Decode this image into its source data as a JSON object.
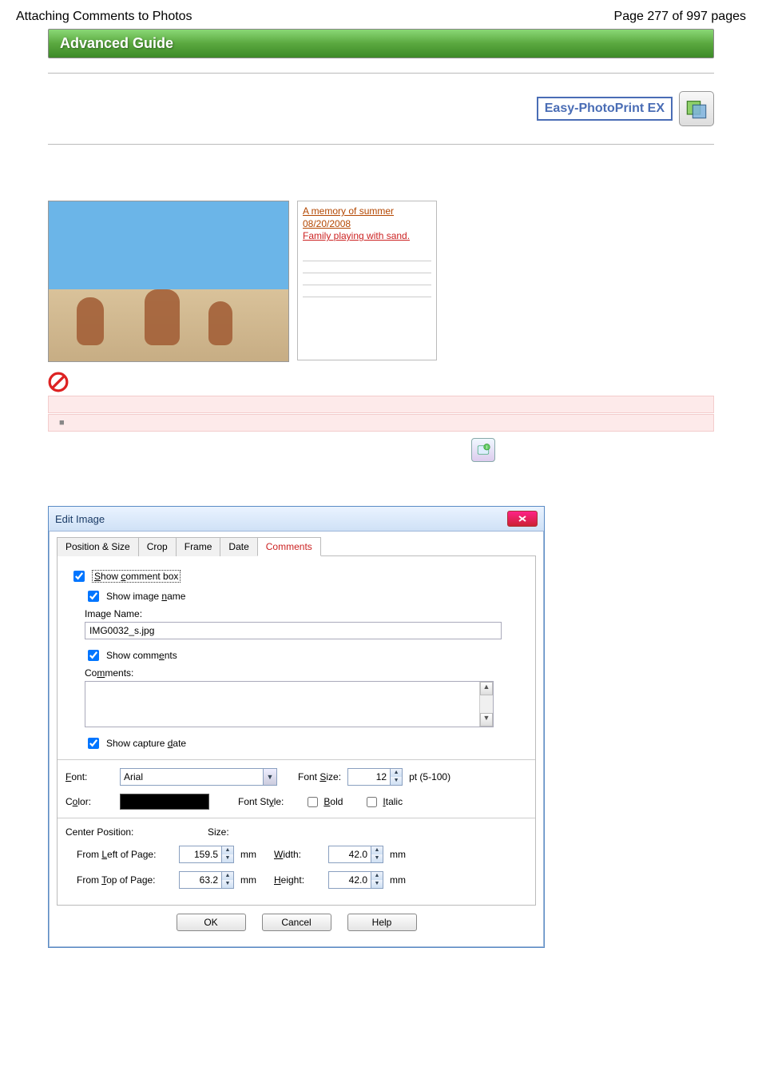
{
  "header": {
    "title_left": "Attaching Comments to Photos",
    "title_right": "Page 277 of 997 pages",
    "bar": "Advanced Guide",
    "brand": "Easy-PhotoPrint EX"
  },
  "comment_panel": {
    "line1": "A memory of summer",
    "line2": "08/20/2008",
    "body": "Family playing with sand."
  },
  "pink_marker": "■",
  "dialog": {
    "title": "Edit Image",
    "tabs": [
      "Position & Size",
      "Crop",
      "Frame",
      "Date",
      "Comments"
    ],
    "active_tab": 4,
    "show_comment_box": {
      "label": "Show comment box",
      "checked": true
    },
    "show_image_name": {
      "label": "Show image name",
      "checked": true
    },
    "image_name_label": "Image Name:",
    "image_name_value": "IMG0032_s.jpg",
    "show_comments": {
      "label": "Show comments",
      "checked": true
    },
    "comments_label": "Comments:",
    "comments_value": "",
    "show_capture_date": {
      "label": "Show capture date",
      "checked": true
    },
    "font_label": "Font:",
    "font_value": "Arial",
    "font_size_label": "Font Size:",
    "font_size_value": "12",
    "font_size_range": "pt (5-100)",
    "color_label": "Color:",
    "color_value": "#000000",
    "font_style_label": "Font Style:",
    "bold_label": "Bold",
    "bold_checked": false,
    "italic_label": "Italic",
    "italic_checked": false,
    "center_pos_label": "Center Position:",
    "size_label": "Size:",
    "from_left_label": "From Left of Page:",
    "from_left_value": "159.5",
    "from_top_label": "From Top of Page:",
    "from_top_value": "63.2",
    "width_label": "Width:",
    "width_value": "42.0",
    "height_label": "Height:",
    "height_value": "42.0",
    "unit": "mm",
    "ok": "OK",
    "cancel": "Cancel",
    "help": "Help"
  }
}
